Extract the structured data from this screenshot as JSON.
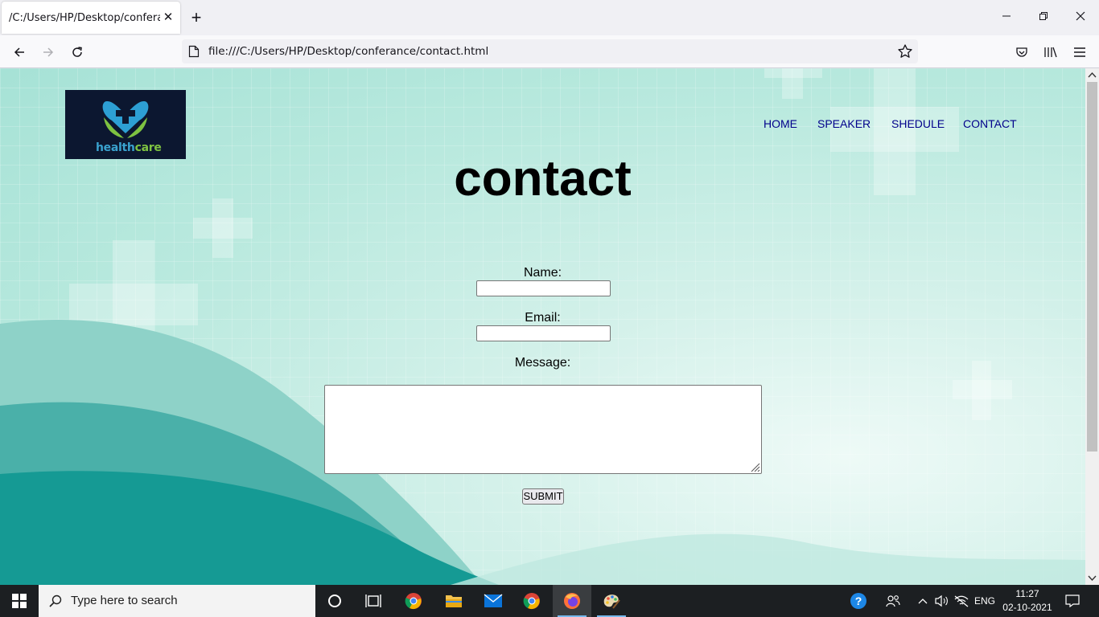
{
  "browser": {
    "tab_title": "/C:/Users/HP/Desktop/conferance/c",
    "url": "file:///C:/Users/HP/Desktop/conferance/contact.html"
  },
  "page": {
    "logo": {
      "word_a": "health",
      "word_b": "care"
    },
    "nav": [
      "HOME",
      "SPEAKER",
      "SHEDULE",
      "CONTACT"
    ],
    "heading": "contact",
    "form": {
      "name_label": "Name:",
      "name_value": "",
      "email_label": "Email:",
      "email_value": "",
      "message_label": "Message:",
      "message_value": "",
      "submit_label": "SUBMIT"
    },
    "colors": {
      "nav_link": "#00008b",
      "wave_dark": "#159a94",
      "background": "#b9e9de"
    }
  },
  "taskbar": {
    "search_placeholder": "Type here to search",
    "language": "ENG",
    "time": "11:27",
    "date": "02-10-2021",
    "apps": [
      "cortana-icon",
      "task-view-icon",
      "chrome-icon",
      "file-explorer-icon",
      "mail-icon",
      "chrome-icon",
      "firefox-icon",
      "paint-icon"
    ]
  }
}
